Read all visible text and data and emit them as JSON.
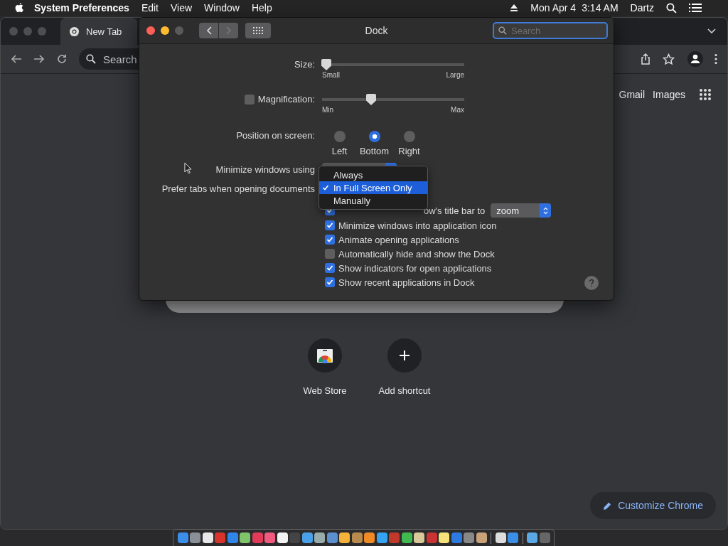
{
  "menu_bar": {
    "app": "System Preferences",
    "menus": [
      "Edit",
      "View",
      "Window",
      "Help"
    ],
    "date": "Mon Apr 4",
    "time": "3:14 AM",
    "user": "Dartz"
  },
  "browser": {
    "tab": {
      "title": "New Tab"
    },
    "omnibox": {
      "placeholder": "Search"
    },
    "links": [
      "Gmail",
      "Images"
    ],
    "shortcuts": [
      {
        "label": "Web Store",
        "kind": "store"
      },
      {
        "label": "Add shortcut",
        "kind": "add"
      }
    ],
    "customize_button": "Customize Chrome"
  },
  "prefs_window": {
    "title": "Dock",
    "search": {
      "placeholder": "Search"
    },
    "size": {
      "label": "Size:",
      "level": 0.03,
      "min_label": "Small",
      "max_label": "Large"
    },
    "magnification": {
      "label": "Magnification:",
      "checked": false,
      "level": 0.345,
      "min_label": "Min",
      "max_label": "Max"
    },
    "position": {
      "label": "Position on screen:",
      "options": [
        {
          "label": "Left",
          "selected": false
        },
        {
          "label": "Bottom",
          "selected": true
        },
        {
          "label": "Right",
          "selected": false
        }
      ]
    },
    "minimize_label": "Minimize windows using",
    "prefer_tabs_label": "Prefer tabs when opening documents",
    "double_click": {
      "label": "ow's title bar to",
      "checked": true,
      "value": "zoom"
    },
    "options": [
      {
        "label": "Minimize windows into application icon",
        "checked": true
      },
      {
        "label": "Animate opening applications",
        "checked": true
      },
      {
        "label": "Automatically hide and show the Dock",
        "checked": false
      },
      {
        "label": "Show indicators for open applications",
        "checked": true
      },
      {
        "label": "Show recent applications in Dock",
        "checked": true
      }
    ]
  },
  "popup_menu": {
    "items": [
      {
        "label": "Always",
        "selected": false
      },
      {
        "label": "In Full Screen Only",
        "selected": true
      },
      {
        "label": "Manually",
        "selected": false
      }
    ]
  }
}
